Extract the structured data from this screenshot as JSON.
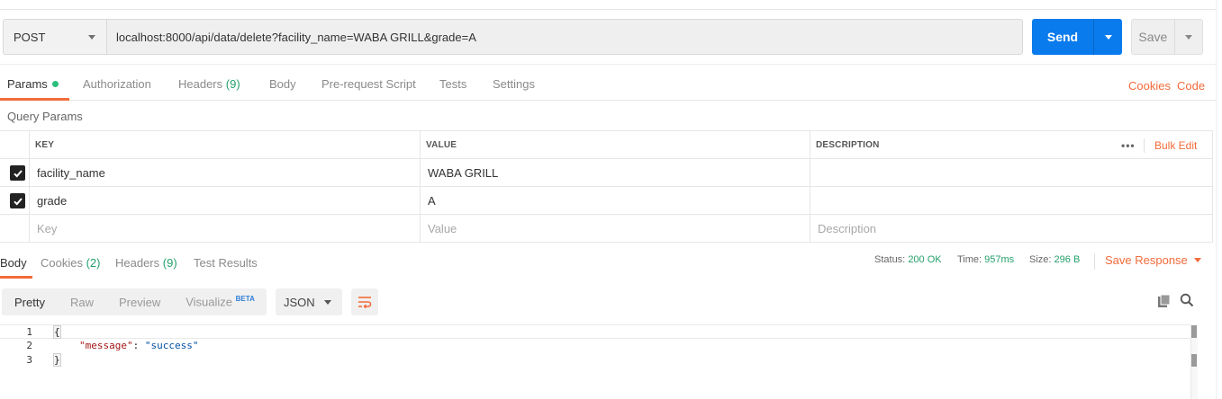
{
  "request": {
    "method": "POST",
    "url": "localhost:8000/api/data/delete?facility_name=WABA GRILL&grade=A",
    "send_label": "Send",
    "save_label": "Save"
  },
  "tabs": {
    "params": "Params",
    "authorization": "Authorization",
    "headers": "Headers",
    "headers_count": "(9)",
    "body": "Body",
    "prerequest": "Pre-request Script",
    "tests": "Tests",
    "settings": "Settings",
    "cookies": "Cookies",
    "code": "Code"
  },
  "query_params": {
    "title": "Query Params",
    "headers": {
      "key": "KEY",
      "value": "VALUE",
      "description": "DESCRIPTION"
    },
    "bulk_edit": "Bulk Edit",
    "more": "•••",
    "rows": [
      {
        "key": "facility_name",
        "value": "WABA GRILL",
        "description": "",
        "checked": true
      },
      {
        "key": "grade",
        "value": "A",
        "description": "",
        "checked": true
      }
    ],
    "placeholders": {
      "key": "Key",
      "value": "Value",
      "description": "Description"
    }
  },
  "response": {
    "tabs": {
      "body": "Body",
      "cookies": "Cookies",
      "cookies_count": "(2)",
      "headers": "Headers",
      "headers_count": "(9)",
      "test_results": "Test Results"
    },
    "status_label": "Status:",
    "status_value": "200 OK",
    "time_label": "Time:",
    "time_value": "957ms",
    "size_label": "Size:",
    "size_value": "296 B",
    "save_response": "Save Response",
    "formats": {
      "pretty": "Pretty",
      "raw": "Raw",
      "preview": "Preview",
      "visualize": "Visualize",
      "beta": "BETA"
    },
    "language": "JSON",
    "code_lines": {
      "n1": "1",
      "n2": "2",
      "n3": "3",
      "open": "{",
      "key": "\"message\"",
      "colon": ": ",
      "value": "\"success\"",
      "close": "}"
    }
  },
  "colors": {
    "accent_orange": "#f26b3a",
    "send_blue": "#097bed",
    "success_green": "#24a06b"
  }
}
